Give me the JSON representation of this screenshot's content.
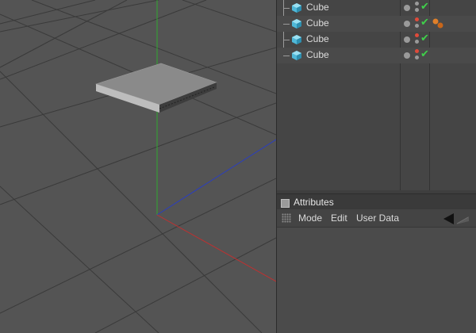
{
  "objects": {
    "rows": [
      {
        "name": "Cube",
        "tag": false
      },
      {
        "name": "Cube",
        "tag": true
      },
      {
        "name": "Cube",
        "tag": false
      },
      {
        "name": "Cube",
        "tag": false
      }
    ]
  },
  "attributes": {
    "title": "Attributes",
    "menu": {
      "mode": "Mode",
      "edit": "Edit",
      "user_data": "User Data"
    }
  },
  "colors": {
    "x_axis": "#c03030",
    "y_axis": "#2fa82f",
    "z_axis": "#2a3ec0",
    "check": "#3fd04a",
    "cube_icon": "#4fb8d8"
  }
}
